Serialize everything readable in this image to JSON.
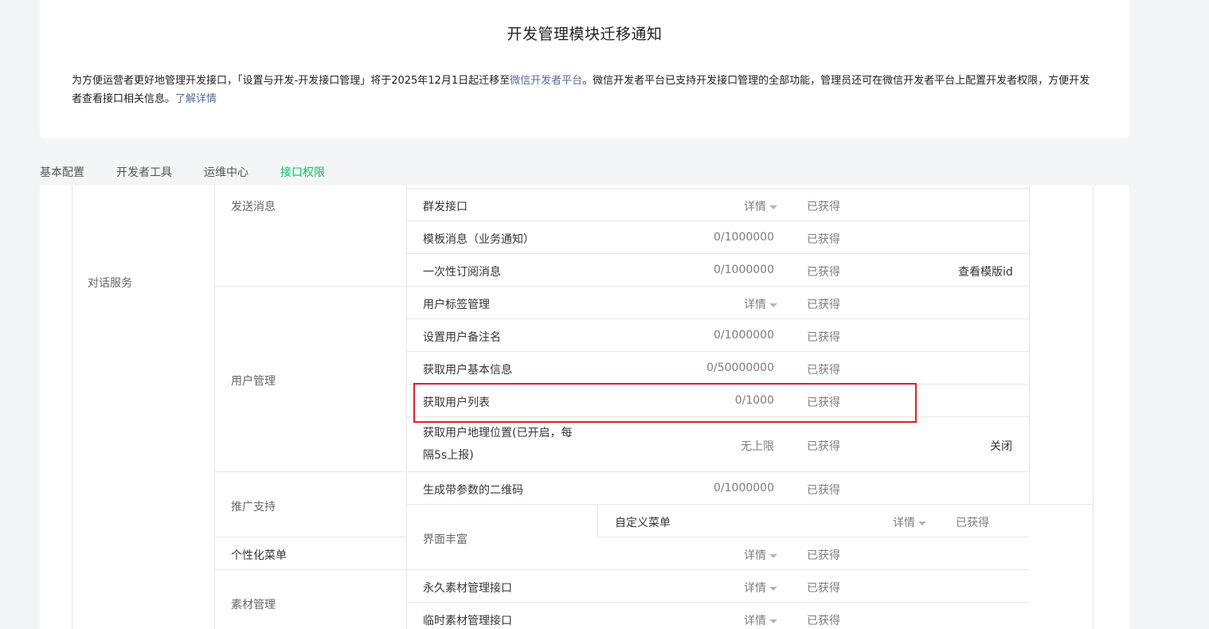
{
  "notice": {
    "title": "开发管理模块迁移通知",
    "body_pre": "为方便运营者更好地管理开发接口，「设置与开发-开发接口管理」将于2025年12月1日起迁移至",
    "body_link": "微信开发者平台",
    "body_mid": "。微信开发者平台已支持开发接口管理的全部功能，管理员还可在微信开发者平台上配置开发者权限，方便开发者查看接口相关信息。",
    "more_link": "了解详情"
  },
  "tabs": [
    {
      "label": "基本配置",
      "active": false
    },
    {
      "label": "开发者工具",
      "active": false
    },
    {
      "label": "运维中心",
      "active": false
    },
    {
      "label": "接口权限",
      "active": true
    }
  ],
  "table": {
    "category": "对话服务",
    "groups": {
      "send": "发送消息",
      "user": "用户管理",
      "promo": "推广支持",
      "ui": "界面丰富",
      "personal_menu": "个性化菜单",
      "material": "素材管理"
    },
    "rows": [
      {
        "name": "群发接口",
        "quota": "详情",
        "quota_is_detail": true,
        "status": "已获得",
        "action": ""
      },
      {
        "name": "模板消息（业务通知）",
        "quota": "0/1000000",
        "quota_is_detail": false,
        "status": "已获得",
        "action": ""
      },
      {
        "name": "一次性订阅消息",
        "quota": "0/1000000",
        "quota_is_detail": false,
        "status": "已获得",
        "action": "查看模版id"
      },
      {
        "name": "用户标签管理",
        "quota": "详情",
        "quota_is_detail": true,
        "status": "已获得",
        "action": ""
      },
      {
        "name": "设置用户备注名",
        "quota": "0/1000000",
        "quota_is_detail": false,
        "status": "已获得",
        "action": ""
      },
      {
        "name": "获取用户基本信息",
        "quota": "0/50000000",
        "quota_is_detail": false,
        "status": "已获得",
        "action": ""
      },
      {
        "name": "获取用户列表",
        "quota": "0/1000",
        "quota_is_detail": false,
        "status": "已获得",
        "action": ""
      },
      {
        "name": "获取用户地理位置(已开启，每隔5s上报)",
        "quota": "无上限",
        "quota_is_detail": false,
        "status": "已获得",
        "action": "关闭"
      },
      {
        "name": "生成带参数的二维码",
        "quota": "0/1000000",
        "quota_is_detail": false,
        "status": "已获得",
        "action": ""
      },
      {
        "name": "自定义菜单",
        "quota": "详情",
        "quota_is_detail": true,
        "status": "已获得",
        "action": ""
      },
      {
        "name": "",
        "quota": "详情",
        "quota_is_detail": true,
        "status": "已获得",
        "action": ""
      },
      {
        "name": "永久素材管理接口",
        "quota": "详情",
        "quota_is_detail": true,
        "status": "已获得",
        "action": ""
      },
      {
        "name": "临时素材管理接口",
        "quota": "详情",
        "quota_is_detail": true,
        "status": "已获得",
        "action": ""
      }
    ]
  }
}
